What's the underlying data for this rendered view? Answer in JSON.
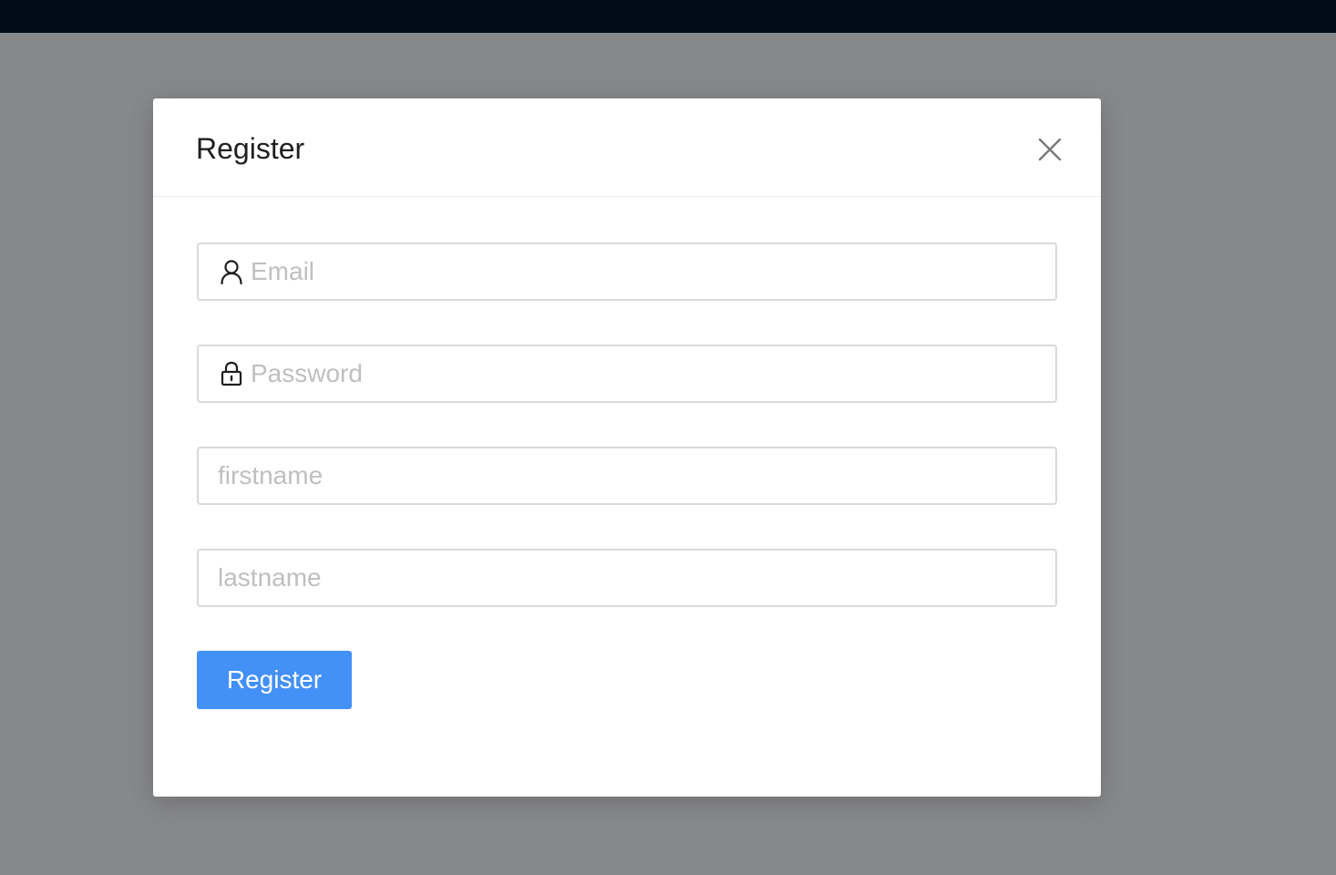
{
  "modal": {
    "title": "Register",
    "close_icon": "close-icon"
  },
  "form": {
    "email": {
      "placeholder": "Email",
      "value": "",
      "icon": "user-icon"
    },
    "password": {
      "placeholder": "Password",
      "value": "",
      "icon": "lock-icon"
    },
    "firstname": {
      "placeholder": "firstname",
      "value": ""
    },
    "lastname": {
      "placeholder": "lastname",
      "value": ""
    },
    "submit_label": "Register"
  },
  "colors": {
    "top_bar": "#000c17",
    "backdrop": "#87888a",
    "primary": "#4390f7",
    "placeholder": "#bfbfbf",
    "border": "#d9d9d9"
  }
}
